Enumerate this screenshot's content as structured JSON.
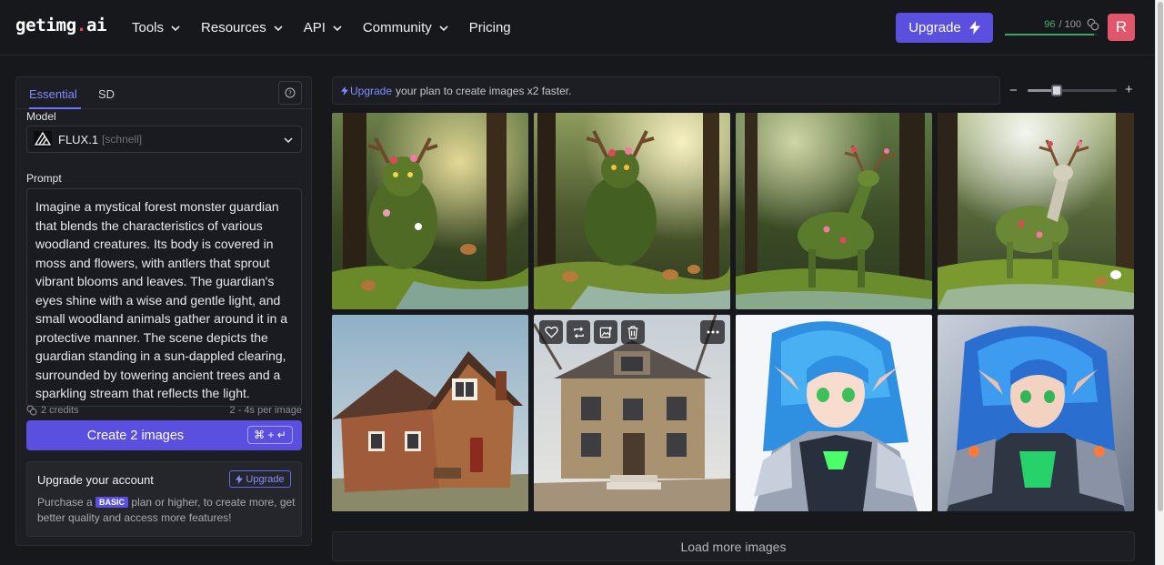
{
  "nav": {
    "logo": {
      "prefix": "getimg",
      "dot": ".",
      "suffix": "ai"
    },
    "menu": [
      {
        "label": "Tools",
        "has_dropdown": true
      },
      {
        "label": "Resources",
        "has_dropdown": true
      },
      {
        "label": "API",
        "has_dropdown": true
      },
      {
        "label": "Community",
        "has_dropdown": true
      },
      {
        "label": "Pricing",
        "has_dropdown": false
      }
    ],
    "upgrade_label": "Upgrade",
    "credits": {
      "used": "96",
      "total": "/ 100",
      "fraction": 0.96
    },
    "avatar_letter": "R"
  },
  "panel": {
    "tabs": [
      {
        "label": "Essential",
        "active": true
      },
      {
        "label": "SD",
        "active": false
      }
    ],
    "model_label": "Model",
    "model": {
      "name": "FLUX.1",
      "variant": "[schnell]"
    },
    "prompt_label": "Prompt",
    "prompt_text": "Imagine a mystical forest monster guardian that blends the characteristics of various woodland creatures. Its body is covered in moss and flowers, with antlers that sprout vibrant blooms and leaves. The guardian's eyes shine with a wise and gentle light, and small woodland animals gather around it in a protective manner. The scene depicts the guardian standing in a sun-dappled clearing, surrounded by towering ancient trees and a sparkling stream that reflects the light.",
    "credits_cost": "2 credits",
    "time_estimate": "2 - 4s per image",
    "create_label": "Create 2 images",
    "shortcut": "⌘ + ↵",
    "upgrade_card": {
      "title": "Upgrade your account",
      "button": "Upgrade",
      "desc_before": "Purchase a",
      "badge": "BASIC",
      "desc_after": "plan or higher, to create more, get better quality and access more features!"
    }
  },
  "banner": {
    "link": "Upgrade",
    "text": "your plan to create images x2 faster."
  },
  "zoom": {
    "level": 0.33
  },
  "gallery": {
    "images": [
      {
        "subject": "forest-guardian-monster",
        "scene": "forest"
      },
      {
        "subject": "forest-guardian-monster",
        "scene": "forest"
      },
      {
        "subject": "flowered-deer",
        "scene": "forest"
      },
      {
        "subject": "flowered-deer",
        "scene": "forest"
      },
      {
        "subject": "brick-cottage",
        "scene": "house"
      },
      {
        "subject": "old-house",
        "scene": "house",
        "hovered": true
      },
      {
        "subject": "anime-elf-warrior",
        "scene": "anime-light"
      },
      {
        "subject": "anime-elf-warrior",
        "scene": "anime-dark"
      }
    ],
    "tile_actions": [
      "heart-icon",
      "regenerate-icon",
      "image-edit-icon",
      "trash-icon"
    ],
    "load_more_label": "Load more images"
  },
  "colors": {
    "accent": "#5b4fe0",
    "accent_text": "#7f8cff",
    "credits_bar": "#3fa562",
    "avatar": "#e2566c",
    "background": "#17181c"
  }
}
